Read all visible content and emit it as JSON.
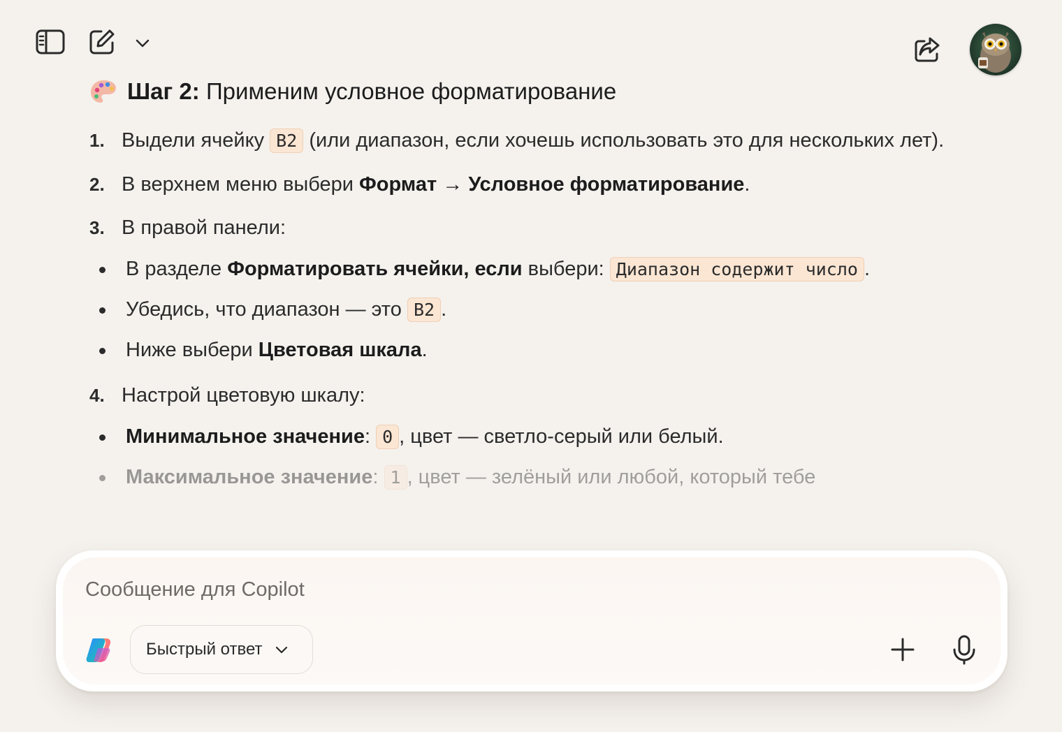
{
  "toolbar": {
    "sidebar_icon": "sidebar-toggle-icon",
    "compose_icon": "new-chat-icon",
    "menu_icon": "chevron-down-icon",
    "share_icon": "share-icon"
  },
  "message": {
    "heading_prefix": "Шаг 2:",
    "heading_text": " Применим условное форматирование",
    "steps": [
      {
        "num": "1.",
        "text_a": "Выдели ячейку ",
        "code": "B2",
        "text_b": " (или диапазон, если хочешь использовать это для нескольких лет)."
      },
      {
        "num": "2.",
        "text_a": "В верхнем меню выбери ",
        "bold": "Формат → Условное форматирование",
        "text_b": "."
      },
      {
        "num": "3.",
        "text": "В правой панели:",
        "bullets": [
          {
            "text_a": "В разделе ",
            "bold": "Форматировать ячейки, если",
            "text_b": " выбери: ",
            "code": "Диапазон содержит число",
            "text_c": "."
          },
          {
            "text_a": "Убедись, что диапазон — это ",
            "code": "B2",
            "text_b": "."
          },
          {
            "text_a": "Ниже выбери ",
            "bold": "Цветовая шкала",
            "text_b": "."
          }
        ]
      },
      {
        "num": "4.",
        "text": "Настрой цветовую шкалу:",
        "bullets": [
          {
            "bold": "Минимальное значение",
            "text_a": ": ",
            "code": "0",
            "text_b": ", цвет — светло-серый или белый."
          },
          {
            "bold": "Максимальное значение",
            "text_a": ": ",
            "code": "1",
            "text_b": ", цвет — зелёный или любой, который тебе"
          }
        ]
      }
    ]
  },
  "composer": {
    "placeholder": "Сообщение для Copilot",
    "mode_label": "Быстрый ответ",
    "plus_icon": "plus-icon",
    "mic_icon": "microphone-icon"
  }
}
